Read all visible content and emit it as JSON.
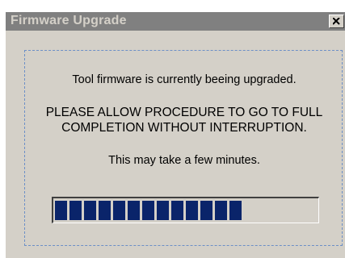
{
  "window": {
    "title": "Firmware Upgrade",
    "close_label": "close-icon"
  },
  "message": {
    "line1": "Tool firmware is currently beeing upgraded.",
    "line2a": "PLEASE ALLOW PROCEDURE TO GO TO FULL",
    "line2b": "COMPLETION WITHOUT INTERRUPTION.",
    "line3": "This may take a few minutes."
  },
  "progress": {
    "fraction": 0.72,
    "filled_segments": 13,
    "color": "#0a246a"
  },
  "colors": {
    "face": "#d4d0c8",
    "title_bar_inactive": "#808080",
    "panel_border": "#6c8fc7"
  }
}
